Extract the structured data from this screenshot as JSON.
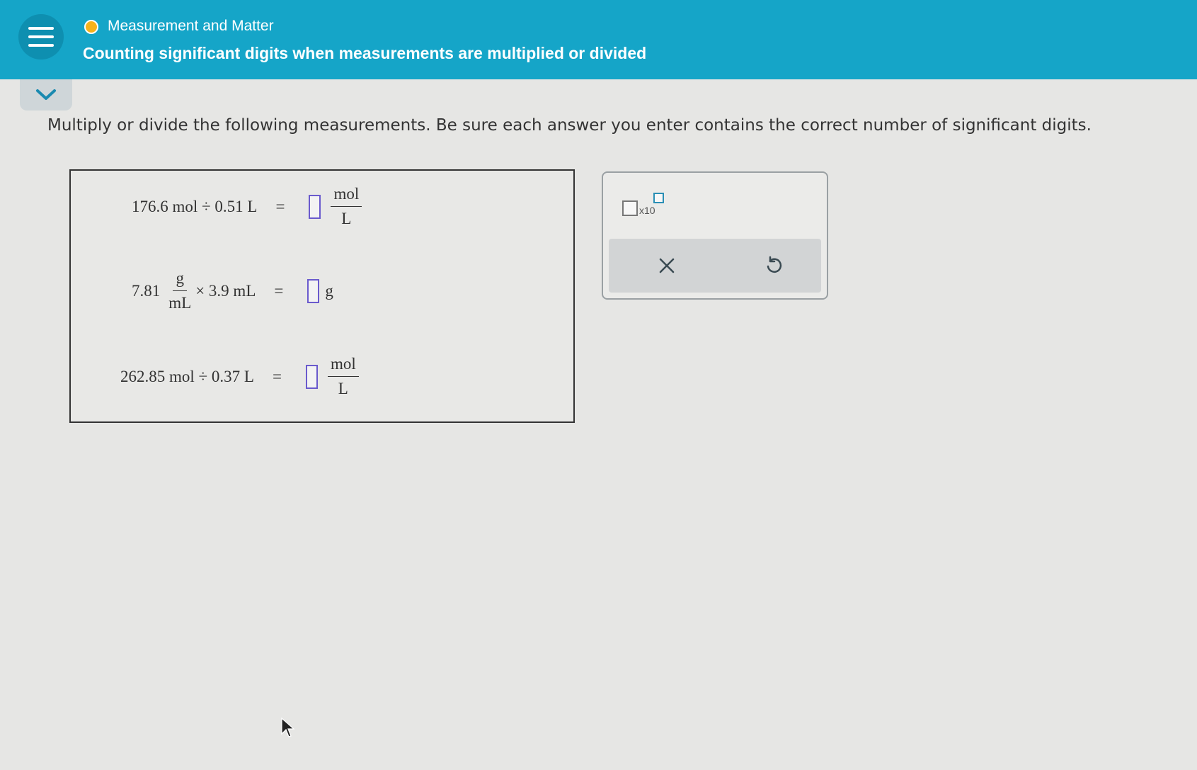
{
  "header": {
    "topic": "Measurement and Matter",
    "title": "Counting significant digits when measurements are multiplied or divided"
  },
  "instructions": "Multiply or divide the following measurements. Be sure each answer you enter contains the correct number of significant digits.",
  "problems": [
    {
      "lhs": "176.6 mol ÷ 0.51 L",
      "eq": "=",
      "unit_num": "mol",
      "unit_den": "L"
    },
    {
      "lhs_value": "7.81",
      "lhs_num": "g",
      "lhs_den": "mL",
      "lhs_rest": "× 3.9 mL",
      "eq": "=",
      "unit": "g"
    },
    {
      "lhs": "262.85 mol ÷ 0.37 L",
      "eq": "=",
      "unit_num": "mol",
      "unit_den": "L"
    }
  ],
  "tools": {
    "x10_label": "x10",
    "clear_icon": "close-icon",
    "undo_icon": "undo-icon"
  },
  "colors": {
    "header_bg": "#15a5c8",
    "topic_dot": "#f5b21b",
    "answer_box_border": "#6a5acd"
  }
}
